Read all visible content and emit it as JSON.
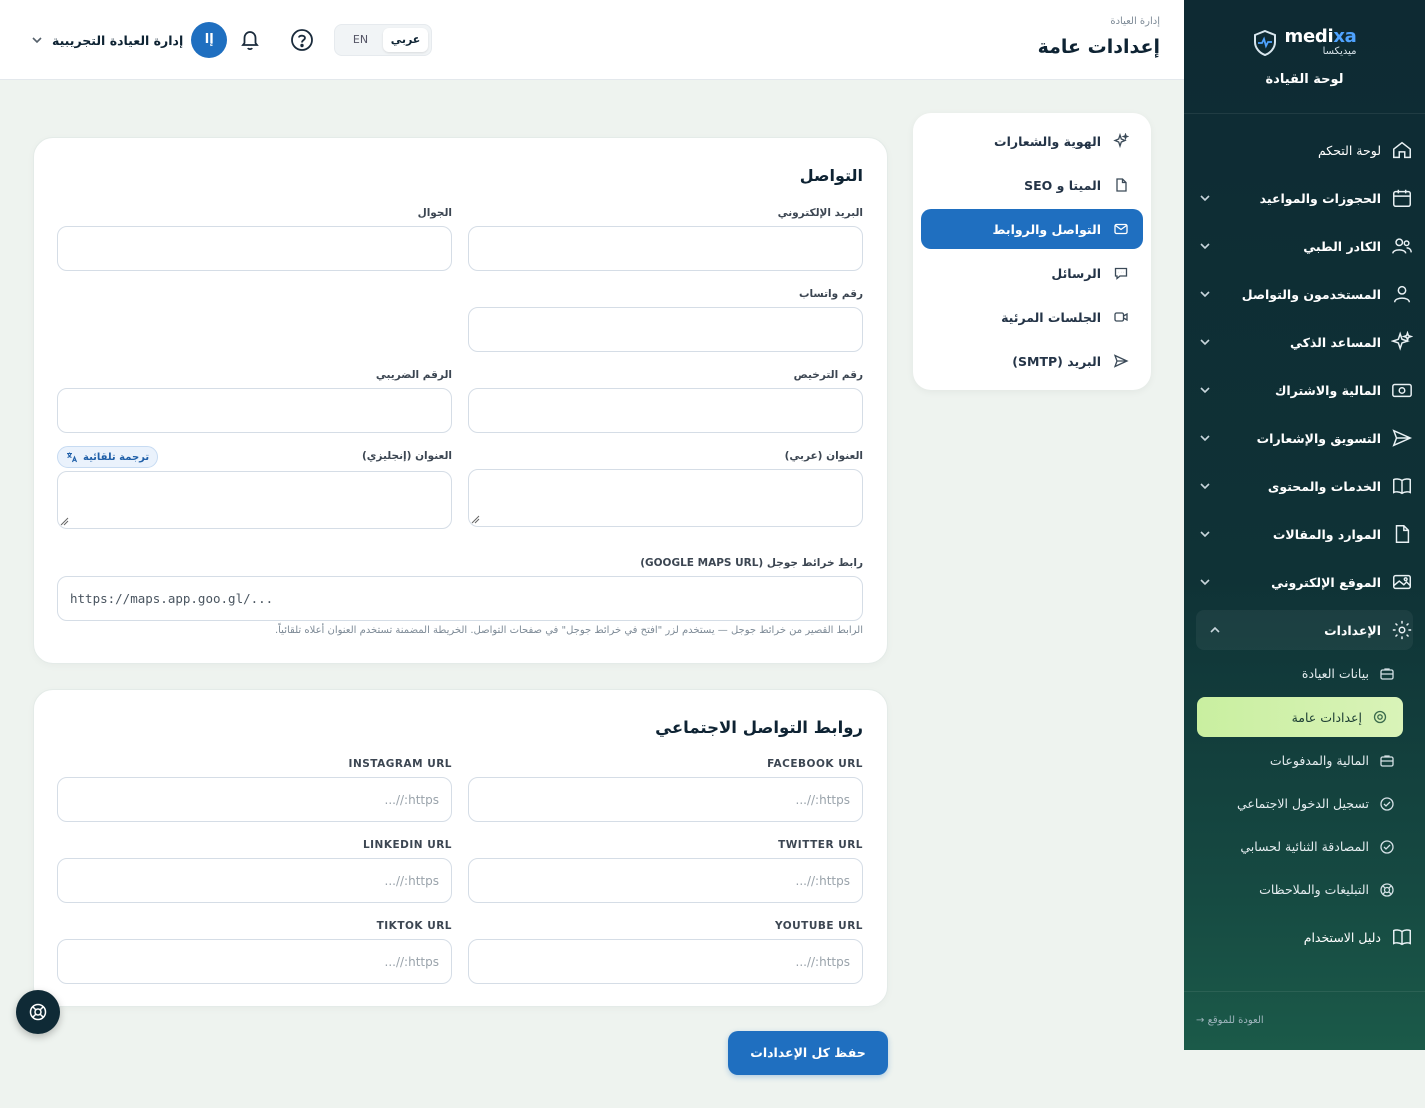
{
  "brand": {
    "name_part1": "medi",
    "name_part2": "xa",
    "name_ar": "ميديكسا",
    "title": "لوحة القيادة"
  },
  "sidebar": {
    "items": [
      {
        "label": "لوحة التحكم",
        "icon": "home-icon"
      },
      {
        "label": "الحجوزات والمواعيد",
        "icon": "calendar-icon"
      },
      {
        "label": "الكادر الطبي",
        "icon": "users-icon"
      },
      {
        "label": "المستخدمون والتواصل",
        "icon": "user-icon"
      },
      {
        "label": "المساعد الذكي",
        "icon": "sparkles-icon"
      },
      {
        "label": "المالية والاشتراك",
        "icon": "cash-icon"
      },
      {
        "label": "التسويق والإشعارات",
        "icon": "send-icon"
      },
      {
        "label": "الخدمات والمحتوى",
        "icon": "book-icon"
      },
      {
        "label": "الموارد والمقالات",
        "icon": "file-icon"
      },
      {
        "label": "الموقع الإلكتروني",
        "icon": "image-icon"
      },
      {
        "label": "الإعدادات",
        "icon": "gear-icon"
      }
    ],
    "settings_sub": [
      {
        "label": "بيانات العيادة"
      },
      {
        "label": "إعدادات عامة"
      },
      {
        "label": "المالية والمدفوعات"
      },
      {
        "label": "تسجيل الدخول الاجتماعي"
      },
      {
        "label": "المصادقة الثنائية لحسابي"
      },
      {
        "label": "التبليغات والملاحظات"
      }
    ],
    "guide": "دليل الاستخدام",
    "back": "العودة للموقع"
  },
  "header": {
    "breadcrumb": "إدارة العيادة",
    "title": "إعدادات عامة",
    "lang_ar": "عربي",
    "lang_en": "EN",
    "avatar_initial": "إا",
    "user_name": "إدارة العيادة التجريبية"
  },
  "tabs": [
    {
      "label": "الهوية والشعارات"
    },
    {
      "label": "الميتا و SEO"
    },
    {
      "label": "التواصل والروابط"
    },
    {
      "label": "الرسائل"
    },
    {
      "label": "الجلسات المرئية"
    },
    {
      "label": "البريد (SMTP)"
    }
  ],
  "contact": {
    "title": "التواصل",
    "email_label": "البريد الإلكتروني",
    "mobile_label": "الجوال",
    "whatsapp_label": "رقم واتساب",
    "license_label": "رقم الترخيص",
    "tax_label": "الرقم الضريبي",
    "address_ar_label": "العنوان (عربي)",
    "address_en_label": "العنوان (إنجليزي)",
    "auto_translate": "ترجمة تلقائية",
    "maps_label": "رابط خرائط جوجل (GOOGLE MAPS URL)",
    "maps_value": "https://maps.app.goo.gl/...",
    "maps_hint": "الرابط القصير من خرائط جوجل — يستخدم لزر \"افتح في خرائط جوجل\" في صفحات التواصل. الخريطة المضمنة تستخدم العنوان أعلاه تلقائياً."
  },
  "social": {
    "title": "روابط التواصل الاجتماعي",
    "placeholder": "https://...",
    "facebook_label": "FACEBOOK URL",
    "instagram_label": "INSTAGRAM URL",
    "twitter_label": "TWITTER URL",
    "linkedin_label": "LINKEDIN URL",
    "youtube_label": "YOUTUBE URL",
    "tiktok_label": "TIKTOK URL"
  },
  "actions": {
    "save": "حفظ كل الإعدادات"
  },
  "colors": {
    "primary": "#1f6fc0",
    "sidebar": "#0e2a33",
    "active_sub": "#c9efa0"
  }
}
